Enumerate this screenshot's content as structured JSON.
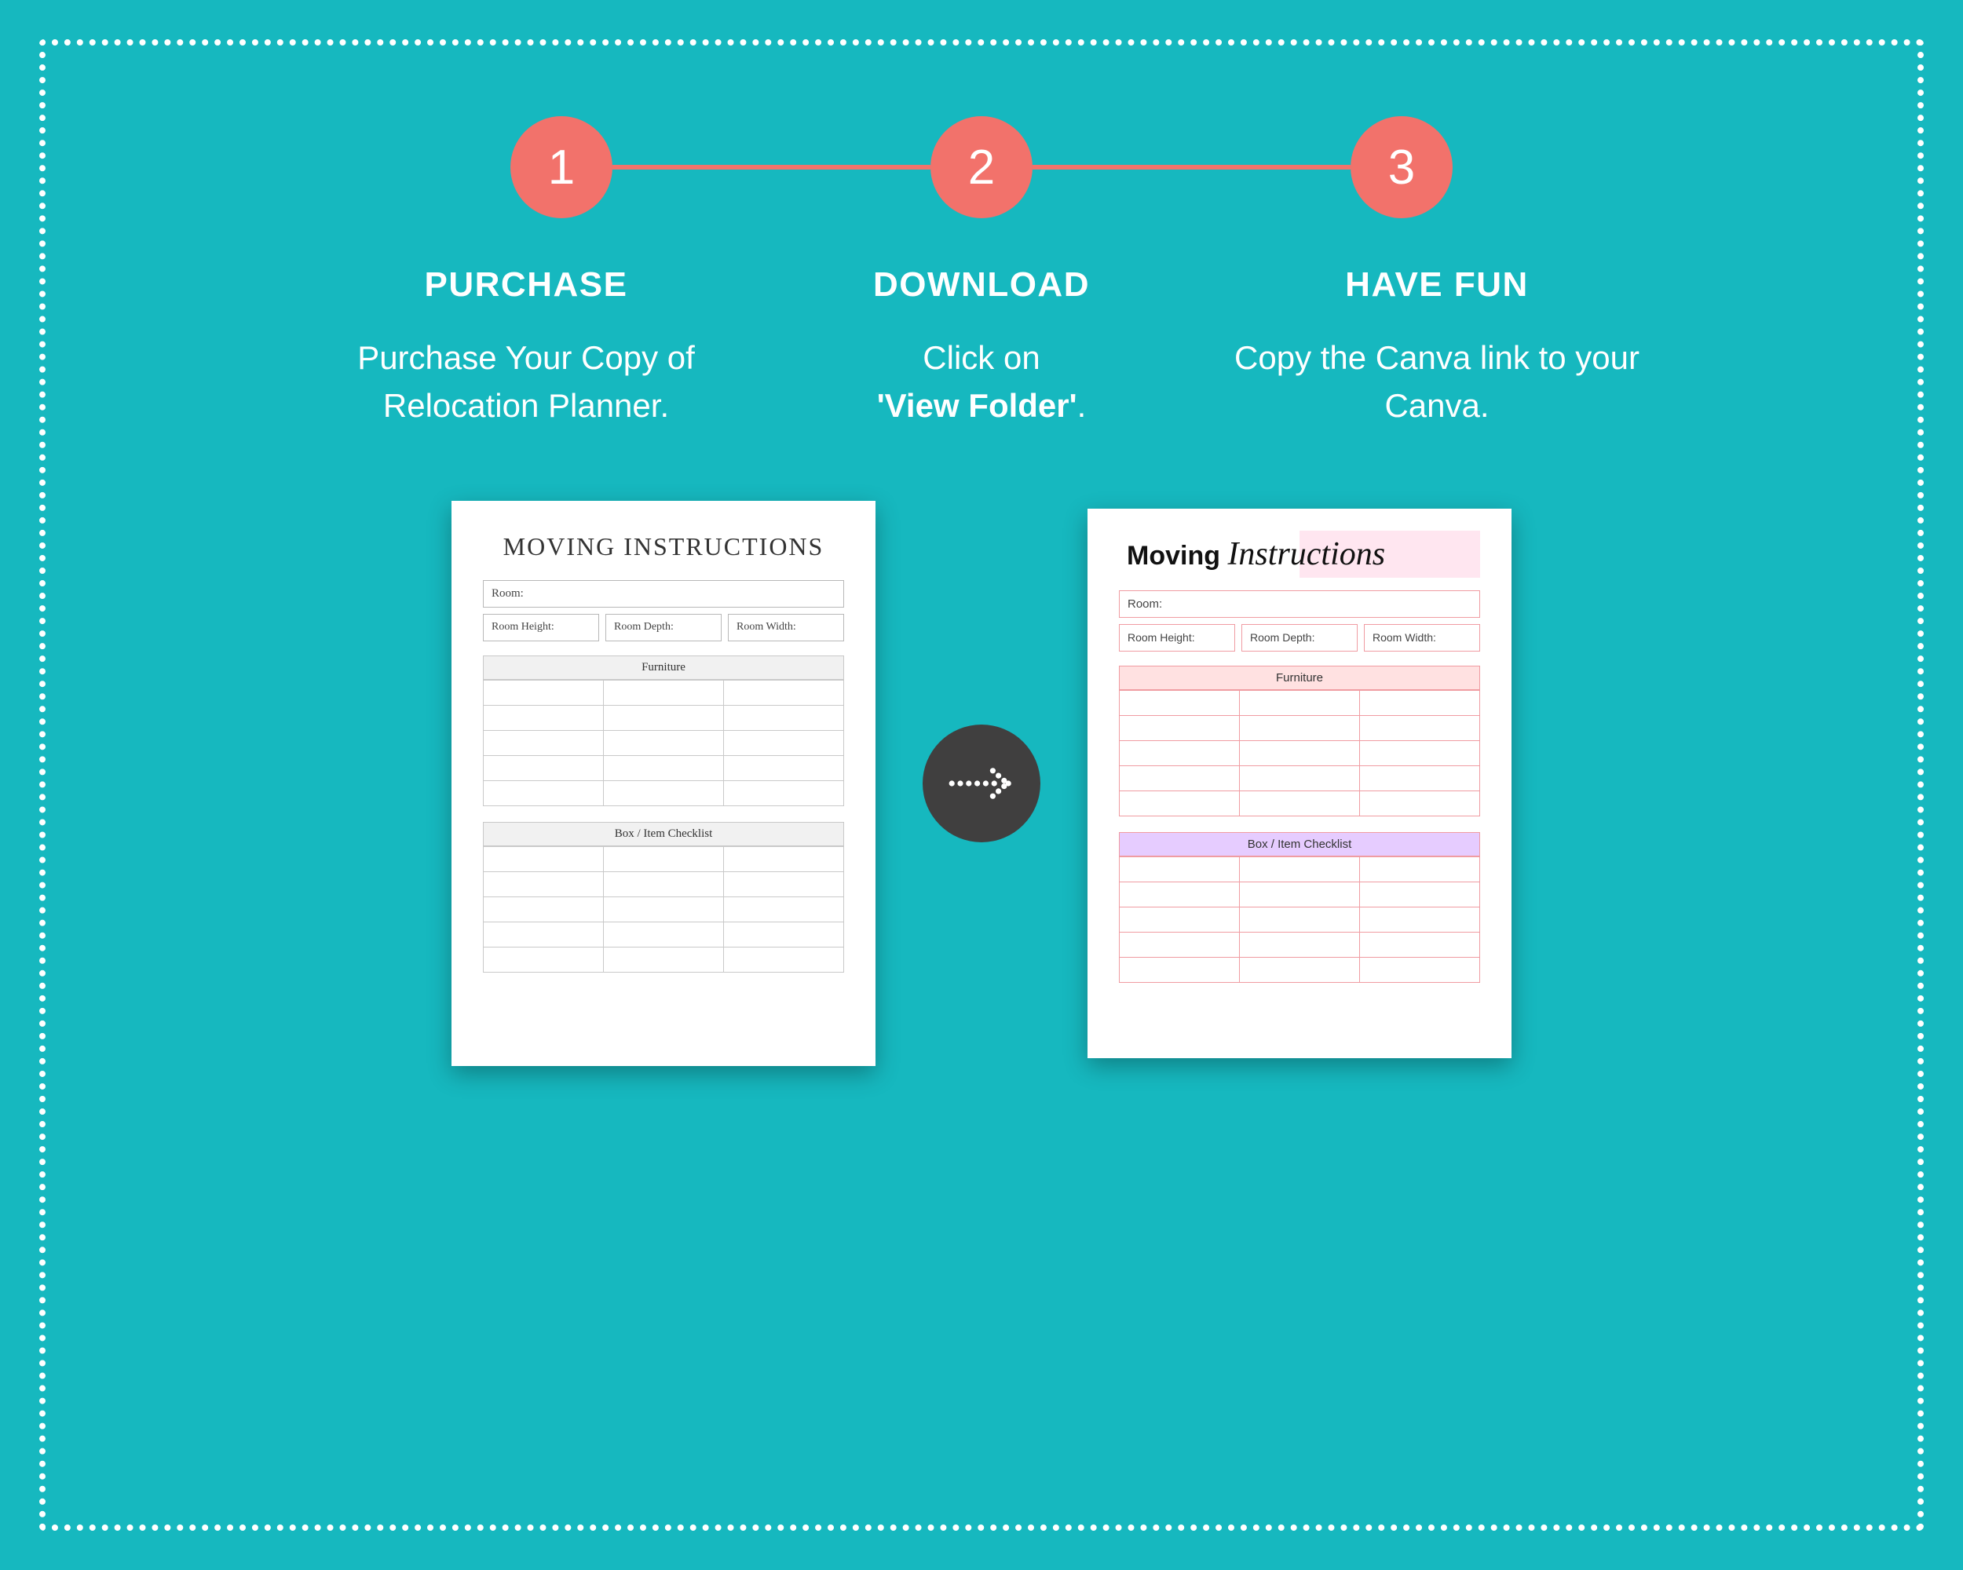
{
  "steps": {
    "numbers": [
      "1",
      "2",
      "3"
    ],
    "items": [
      {
        "title": "PURCHASE",
        "body": "Purchase Your Copy of Relocation Planner."
      },
      {
        "title": "DOWNLOAD",
        "body_pre": "Click  on",
        "body_bold": "'View Folder'",
        "body_post": "."
      },
      {
        "title": "HAVE FUN",
        "body": "Copy the Canva link to your Canva."
      }
    ]
  },
  "preview": {
    "mono": {
      "title": "MOVING INSTRUCTIONS",
      "room_label": "Room:",
      "room_height": "Room Height:",
      "room_depth": "Room Depth:",
      "room_width": "Room Width:",
      "furniture_head": "Furniture",
      "checklist_head": "Box / Item Checklist"
    },
    "color": {
      "title_1": "Moving",
      "title_2": "Instructions",
      "room_label": "Room:",
      "room_height": "Room Height:",
      "room_depth": "Room Depth:",
      "room_width": "Room Width:",
      "furniture_head": "Furniture",
      "checklist_head": "Box / Item Checklist"
    }
  },
  "colors": {
    "bg": "#16b8bf",
    "accent": "#f2726b",
    "arrow_bg": "#403f3f"
  }
}
